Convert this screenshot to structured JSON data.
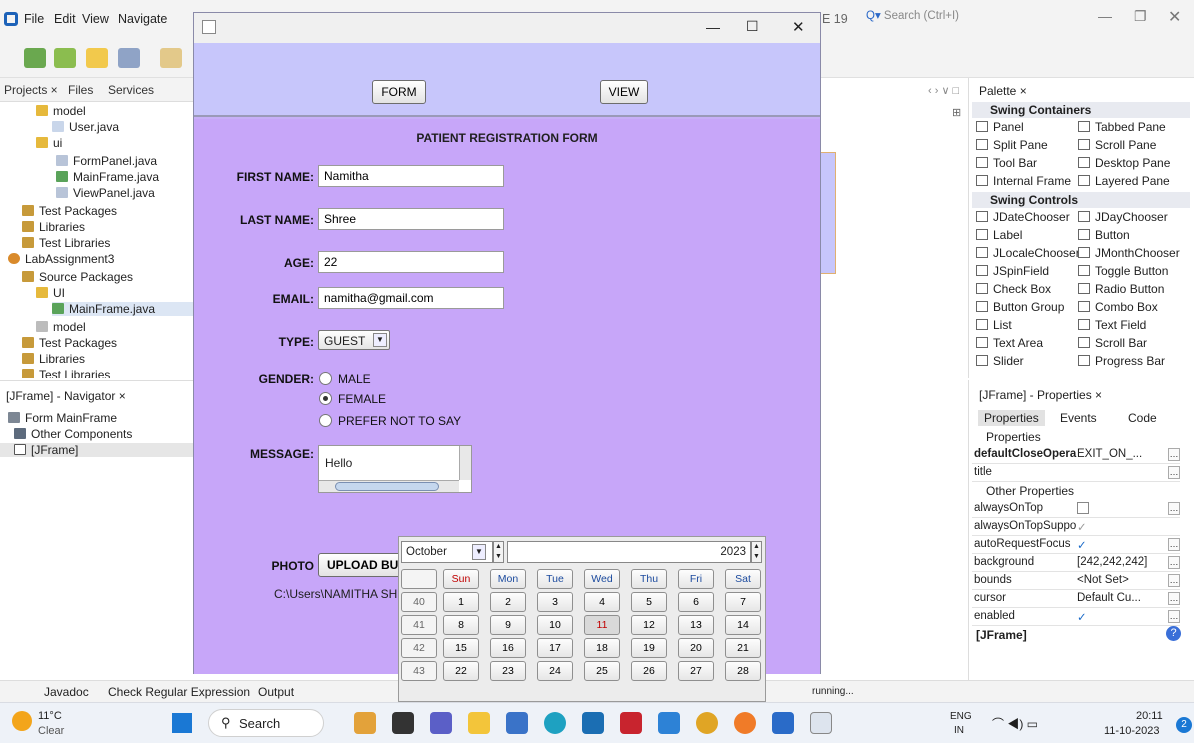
{
  "ide": {
    "menu": [
      "File",
      "Edit",
      "View",
      "Navigate"
    ],
    "version_frag": "E 19",
    "search_placeholder": "Search (Ctrl+I)",
    "project_tabs": [
      "Projects ×",
      "Files",
      "Services"
    ],
    "tree": [
      {
        "label": "model",
        "kind": "pkg"
      },
      {
        "label": "User.java",
        "kind": "file"
      },
      {
        "label": "ui",
        "kind": "pkg"
      },
      {
        "label": "FormPanel.java",
        "kind": "file"
      },
      {
        "label": "MainFrame.java",
        "kind": "file"
      },
      {
        "label": "ViewPanel.java",
        "kind": "file"
      },
      {
        "label": "Test Packages",
        "kind": "folder"
      },
      {
        "label": "Libraries",
        "kind": "folder"
      },
      {
        "label": "Test Libraries",
        "kind": "folder"
      },
      {
        "label": "LabAssignment3",
        "kind": "project"
      },
      {
        "label": "Source Packages",
        "kind": "folder"
      },
      {
        "label": "UI",
        "kind": "pkg"
      },
      {
        "label": "MainFrame.java",
        "kind": "file"
      },
      {
        "label": "model",
        "kind": "pkg"
      },
      {
        "label": "Test Packages",
        "kind": "folder"
      },
      {
        "label": "Libraries",
        "kind": "folder"
      },
      {
        "label": "Test Libraries",
        "kind": "folder"
      }
    ],
    "navigator_title": "[JFrame] - Navigator ×",
    "navigator": [
      "Form MainFrame",
      "Other Components",
      "[JFrame]"
    ],
    "palette_title": "Palette ×",
    "palette": {
      "containers_header": "Swing Containers",
      "containers": [
        "Panel",
        "Tabbed Pane",
        "Split Pane",
        "Scroll Pane",
        "Tool Bar",
        "Desktop Pane",
        "Internal Frame",
        "Layered Pane"
      ],
      "controls_header": "Swing Controls",
      "controls": [
        "JDateChooser",
        "JDayChooser",
        "Label",
        "Button",
        "JLocaleChooser",
        "JMonthChooser",
        "JSpinField",
        "Toggle Button",
        "Check Box",
        "Radio Button",
        "Button Group",
        "Combo Box",
        "List",
        "Text Field",
        "Text Area",
        "Scroll Bar",
        "Slider",
        "Progress Bar"
      ]
    },
    "props_title": "[JFrame] - Properties ×",
    "props_tabs": [
      "Properties",
      "Events",
      "Code"
    ],
    "props_section": "Properties",
    "props": [
      {
        "k": "defaultCloseOpera",
        "v": "EXIT_ON_..."
      },
      {
        "k": "title",
        "v": ""
      }
    ],
    "other_section": "Other Properties",
    "other_props": [
      {
        "k": "alwaysOnTop",
        "v": ""
      },
      {
        "k": "alwaysOnTopSuppo",
        "v": "✓"
      },
      {
        "k": "autoRequestFocus",
        "v": "✓"
      },
      {
        "k": "background",
        "v": "[242,242,242]"
      },
      {
        "k": "bounds",
        "v": "<Not Set>"
      },
      {
        "k": "cursor",
        "v": "Default Cu..."
      },
      {
        "k": "enabled",
        "v": "✓"
      }
    ],
    "props_footer": "[JFrame]",
    "status_tabs": [
      "Javadoc",
      "Check Regular Expression",
      "Output"
    ],
    "status_running": "running..."
  },
  "taskbar": {
    "weather_temp": "11°C",
    "weather_desc": "Clear",
    "search": "Search",
    "lang1": "ENG",
    "lang2": "IN",
    "time": "20:11",
    "date": "11-10-2023",
    "notif": "2"
  },
  "app": {
    "form_button": "FORM",
    "view_button": "VIEW",
    "heading": "PATIENT REGISTRATION FORM",
    "labels": {
      "first": "FIRST NAME:",
      "last": "LAST NAME:",
      "age": "AGE:",
      "email": "EMAIL:",
      "type": "TYPE:",
      "gender": "GENDER:",
      "message": "MESSAGE:",
      "photo": "PHOTO"
    },
    "values": {
      "first": "Namitha",
      "last": "Shree",
      "age": "22",
      "email": "namitha@gmail.com",
      "type": "GUEST",
      "message": "Hello"
    },
    "gender_options": [
      "MALE",
      "FEMALE",
      "PREFER NOT TO SAY"
    ],
    "gender_selected": "FEMALE",
    "upload_button": "UPLOAD BUT",
    "photo_path": "C:\\Users\\NAMITHA SHRE"
  },
  "calendar": {
    "month": "October",
    "year": "2023",
    "days": [
      "Sun",
      "Mon",
      "Tue",
      "Wed",
      "Thu",
      "Fri",
      "Sat"
    ],
    "weeks": [
      {
        "wk": "40",
        "d": [
          "1",
          "2",
          "3",
          "4",
          "5",
          "6",
          "7"
        ]
      },
      {
        "wk": "41",
        "d": [
          "8",
          "9",
          "10",
          "11",
          "12",
          "13",
          "14"
        ]
      },
      {
        "wk": "42",
        "d": [
          "15",
          "16",
          "17",
          "18",
          "19",
          "20",
          "21"
        ]
      },
      {
        "wk": "43",
        "d": [
          "22",
          "23",
          "24",
          "25",
          "26",
          "27",
          "28"
        ]
      }
    ],
    "selected": "11"
  }
}
